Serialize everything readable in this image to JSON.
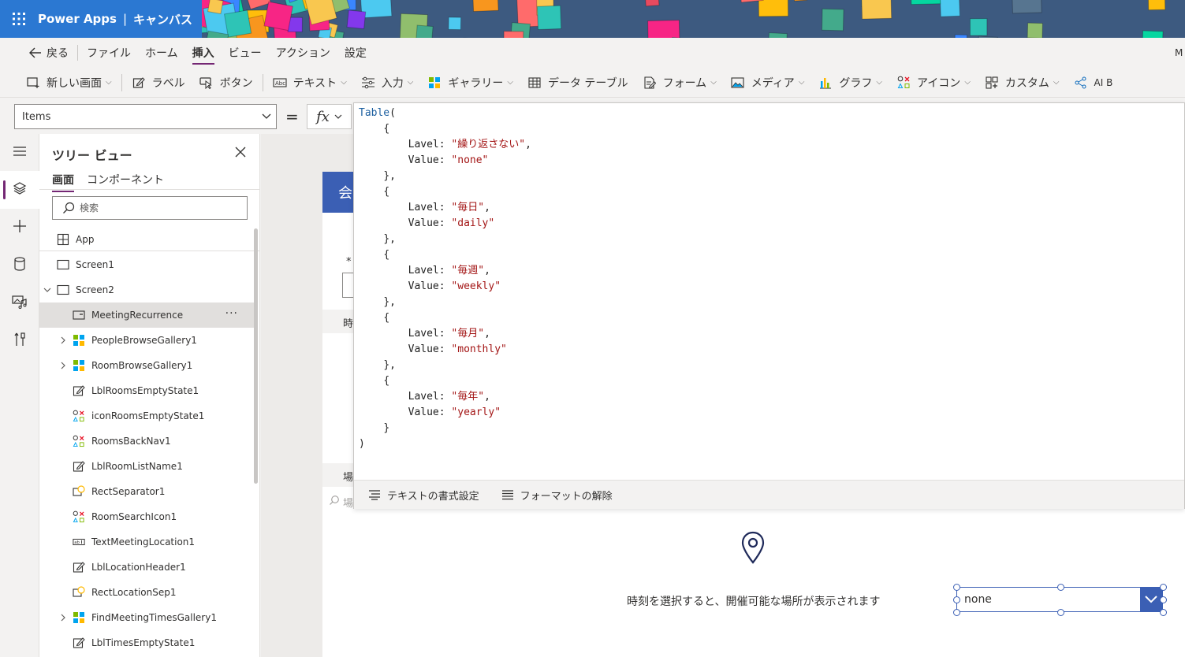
{
  "header": {
    "app_name": "Power Apps",
    "separator": "|",
    "app_type": "キャンバス"
  },
  "menubar": {
    "back_label": "戻る",
    "items": [
      "ファイル",
      "ホーム",
      "挿入",
      "ビュー",
      "アクション",
      "設定"
    ],
    "active_item": "挿入",
    "overflow": "M"
  },
  "ribbon": {
    "items": [
      {
        "label": "新しい画面",
        "icon": "new-screen-icon"
      },
      {
        "label": "ラベル",
        "icon": "label-icon"
      },
      {
        "label": "ボタン",
        "icon": "button-icon"
      },
      {
        "label": "テキスト",
        "icon": "text-icon"
      },
      {
        "label": "入力",
        "icon": "input-icon"
      },
      {
        "label": "ギャラリー",
        "icon": "gallery-icon"
      },
      {
        "label": "データ テーブル",
        "icon": "data-table-icon"
      },
      {
        "label": "フォーム",
        "icon": "form-icon"
      },
      {
        "label": "メディア",
        "icon": "media-icon"
      },
      {
        "label": "グラフ",
        "icon": "chart-icon"
      },
      {
        "label": "アイコン",
        "icon": "icons-icon"
      },
      {
        "label": "カスタム",
        "icon": "custom-icon"
      },
      {
        "label": "AI B",
        "icon": "ai-builder-icon"
      }
    ]
  },
  "formulabar": {
    "property": "Items",
    "equals": "=",
    "fx": "fx"
  },
  "formula": {
    "lines": [
      {
        "indent": 0,
        "parts": [
          {
            "t": "Table",
            "c": "fn"
          },
          {
            "t": "(",
            "c": ""
          }
        ]
      },
      {
        "indent": 1,
        "parts": [
          {
            "t": "{",
            "c": ""
          }
        ]
      },
      {
        "indent": 2,
        "parts": [
          {
            "t": "Lavel: ",
            "c": ""
          },
          {
            "t": "\"繰り返さない\"",
            "c": "str"
          },
          {
            "t": ",",
            "c": ""
          }
        ]
      },
      {
        "indent": 2,
        "parts": [
          {
            "t": "Value: ",
            "c": ""
          },
          {
            "t": "\"none\"",
            "c": "str"
          }
        ]
      },
      {
        "indent": 1,
        "parts": [
          {
            "t": "},",
            "c": ""
          }
        ]
      },
      {
        "indent": 1,
        "parts": [
          {
            "t": "{",
            "c": ""
          }
        ]
      },
      {
        "indent": 2,
        "parts": [
          {
            "t": "Lavel: ",
            "c": ""
          },
          {
            "t": "\"毎日\"",
            "c": "str"
          },
          {
            "t": ",",
            "c": ""
          }
        ]
      },
      {
        "indent": 2,
        "parts": [
          {
            "t": "Value: ",
            "c": ""
          },
          {
            "t": "\"daily\"",
            "c": "str"
          }
        ]
      },
      {
        "indent": 1,
        "parts": [
          {
            "t": "},",
            "c": ""
          }
        ]
      },
      {
        "indent": 1,
        "parts": [
          {
            "t": "{",
            "c": ""
          }
        ]
      },
      {
        "indent": 2,
        "parts": [
          {
            "t": "Lavel: ",
            "c": ""
          },
          {
            "t": "\"毎週\"",
            "c": "str"
          },
          {
            "t": ",",
            "c": ""
          }
        ]
      },
      {
        "indent": 2,
        "parts": [
          {
            "t": "Value: ",
            "c": ""
          },
          {
            "t": "\"weekly\"",
            "c": "str"
          }
        ]
      },
      {
        "indent": 1,
        "parts": [
          {
            "t": "},",
            "c": ""
          }
        ]
      },
      {
        "indent": 1,
        "parts": [
          {
            "t": "{",
            "c": ""
          }
        ]
      },
      {
        "indent": 2,
        "parts": [
          {
            "t": "Lavel: ",
            "c": ""
          },
          {
            "t": "\"毎月\"",
            "c": "str"
          },
          {
            "t": ",",
            "c": ""
          }
        ]
      },
      {
        "indent": 2,
        "parts": [
          {
            "t": "Value: ",
            "c": ""
          },
          {
            "t": "\"monthly\"",
            "c": "str"
          }
        ]
      },
      {
        "indent": 1,
        "parts": [
          {
            "t": "},",
            "c": ""
          }
        ]
      },
      {
        "indent": 1,
        "parts": [
          {
            "t": "{",
            "c": ""
          }
        ]
      },
      {
        "indent": 2,
        "parts": [
          {
            "t": "Lavel: ",
            "c": ""
          },
          {
            "t": "\"毎年\"",
            "c": "str"
          },
          {
            "t": ",",
            "c": ""
          }
        ]
      },
      {
        "indent": 2,
        "parts": [
          {
            "t": "Value: ",
            "c": ""
          },
          {
            "t": "\"yearly\"",
            "c": "str"
          }
        ]
      },
      {
        "indent": 1,
        "parts": [
          {
            "t": "}",
            "c": ""
          }
        ]
      },
      {
        "indent": 0,
        "parts": [
          {
            "t": ")",
            "c": ""
          }
        ]
      }
    ],
    "format_label": "テキストの書式設定",
    "unformat_label": "フォーマットの解除"
  },
  "tree": {
    "title": "ツリー ビュー",
    "tabs": [
      "画面",
      "コンポーネント"
    ],
    "active_tab": "画面",
    "search_placeholder": "検索",
    "items": [
      {
        "label": "App",
        "level": 0,
        "icon": "app-icon",
        "expander": ""
      },
      {
        "label": "Screen1",
        "level": 0,
        "icon": "screen-icon",
        "expander": ""
      },
      {
        "label": "Screen2",
        "level": 0,
        "icon": "screen-icon",
        "expander": "open"
      },
      {
        "label": "MeetingRecurrence",
        "level": 1,
        "icon": "dropdown-control-icon",
        "expander": "",
        "selected": true
      },
      {
        "label": "PeopleBrowseGallery1",
        "level": 1,
        "icon": "gallery-icon",
        "expander": "closed"
      },
      {
        "label": "RoomBrowseGallery1",
        "level": 1,
        "icon": "gallery-icon",
        "expander": "closed"
      },
      {
        "label": "LblRoomsEmptyState1",
        "level": 1,
        "icon": "label-icon",
        "expander": ""
      },
      {
        "label": "iconRoomsEmptyState1",
        "level": 1,
        "icon": "icons-icon",
        "expander": ""
      },
      {
        "label": "RoomsBackNav1",
        "level": 1,
        "icon": "icons-icon",
        "expander": ""
      },
      {
        "label": "LblRoomListName1",
        "level": 1,
        "icon": "label-icon",
        "expander": ""
      },
      {
        "label": "RectSeparator1",
        "level": 1,
        "icon": "shape-icon",
        "expander": ""
      },
      {
        "label": "RoomSearchIcon1",
        "level": 1,
        "icon": "icons-icon",
        "expander": ""
      },
      {
        "label": "TextMeetingLocation1",
        "level": 1,
        "icon": "text-input-icon",
        "expander": ""
      },
      {
        "label": "LblLocationHeader1",
        "level": 1,
        "icon": "label-icon",
        "expander": ""
      },
      {
        "label": "RectLocationSep1",
        "level": 1,
        "icon": "shape-icon",
        "expander": ""
      },
      {
        "label": "FindMeetingTimesGallery1",
        "level": 1,
        "icon": "gallery-icon",
        "expander": "closed"
      },
      {
        "label": "LblTimesEmptyState1",
        "level": 1,
        "icon": "label-icon",
        "expander": ""
      }
    ]
  },
  "canvas": {
    "header_text": "会",
    "asterisk": "*",
    "time_fragment": "時",
    "place_fragment": "場",
    "search_fragment": "場",
    "empty_message": "時刻を選択すると、開催可能な場所が表示されます",
    "dropdown_value": "none"
  },
  "colors": {
    "accent": "#742774",
    "brand_blue": "#3b5fb4",
    "header_blue": "#2b78d2",
    "string_red": "#a31515"
  }
}
